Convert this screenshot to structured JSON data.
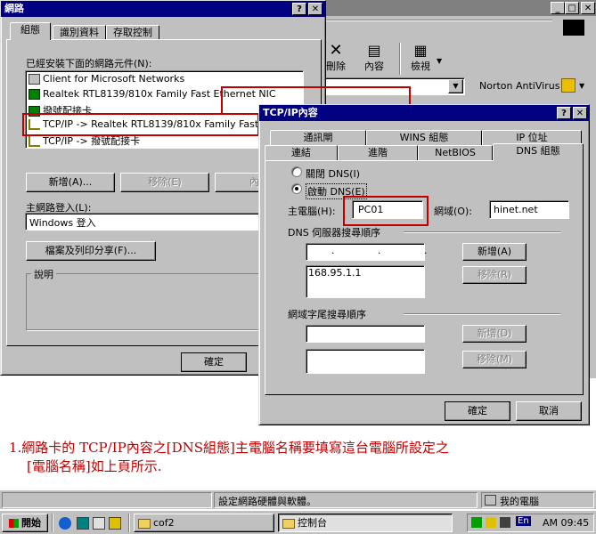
{
  "bg_app": {
    "toolbar": {
      "delete_label": "刪除",
      "properties_label": "內容",
      "view_label": "檢視"
    },
    "norton_label": "Norton AntiVirus"
  },
  "network_dialog": {
    "title": "網路",
    "tabs": [
      "組態",
      "識別資料",
      "存取控制"
    ],
    "components_label": "已經安裝下面的網路元件(N):",
    "components": [
      "Client for Microsoft Networks",
      "Realtek RTL8139/810x Family Fast Ethernet NIC",
      "撥號配接卡",
      "TCP/IP -> Realtek RTL8139/810x Family Fast Ethe",
      "TCP/IP -> 撥號配接卡"
    ],
    "add_button": "新增(A)...",
    "remove_button": "移除(E)",
    "properties_button": "內容",
    "primary_logon_label": "主網路登入(L):",
    "primary_logon_value": "Windows 登入",
    "file_print_button": "檔案及列印分享(F)...",
    "description_label": "說明",
    "ok_button": "確定"
  },
  "tcpip_dialog": {
    "title": "TCP/IP內容",
    "tabs_row1": [
      "通訊閘",
      "WINS 組態",
      "IP 位址"
    ],
    "tabs_row2": [
      "連結",
      "進階",
      "NetBIOS",
      "DNS 組態"
    ],
    "disable_dns": "關閉 DNS(I)",
    "enable_dns": "啟動 DNS(E)",
    "host_label": "主電腦(H):",
    "host_value": "PC01",
    "domain_label": "網域(O):",
    "domain_value": "hinet.net",
    "dns_order_label": "DNS 伺服器搜尋順序",
    "dns_ip_placeholder": ".       .       .",
    "dns_servers": [
      "168.95.1.1"
    ],
    "add_button": "新增(A)",
    "remove_button": "移除(R)",
    "suffix_label": "網域字尾搜尋順序",
    "suffix_add_button": "新增(D)",
    "suffix_remove_button": "移除(M)",
    "ok_button": "確定",
    "cancel_button": "取消"
  },
  "annotation": {
    "line1": "1.網路卡的 TCP/IP內容之[DNS組態]主電腦名稱要填寫這台電腦所設定之",
    "line2": "[電腦名稱]如上頁所示."
  },
  "statusbar": {
    "text": "設定網路硬體與軟體。",
    "my_computer": "我的電腦"
  },
  "taskbar": {
    "start": "開始",
    "task1": "cof2",
    "task2": "控制台",
    "ime": "En",
    "clock": "AM 09:45"
  },
  "colors": {
    "annotation_red": "#c00000",
    "title_blue": "#000080",
    "face": "#c0c0c0"
  }
}
